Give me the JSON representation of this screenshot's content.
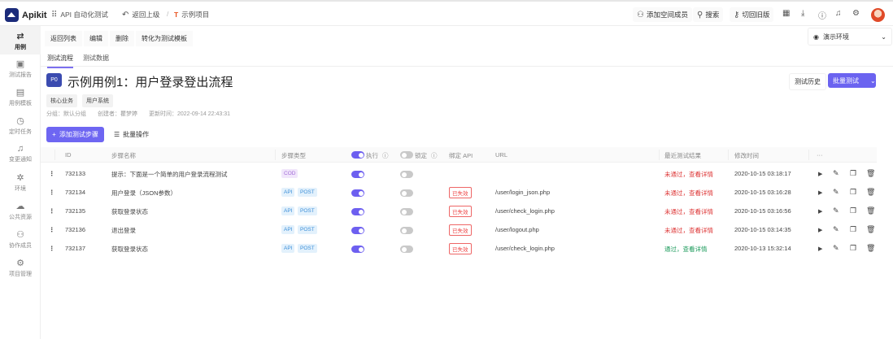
{
  "topbar": {
    "brand": "Apikit",
    "module": "API 自动化测试",
    "back": "返回上级",
    "project": "示例项目",
    "add_member": "添加空间成员",
    "search": "搜索",
    "old_version": "切回旧版"
  },
  "sidebar": {
    "items": [
      {
        "label": "用例",
        "icon": "swap-icon"
      },
      {
        "label": "测试报告",
        "icon": "report-icon"
      },
      {
        "label": "用例模板",
        "icon": "template-icon"
      },
      {
        "label": "定时任务",
        "icon": "timer-icon"
      },
      {
        "label": "变更通知",
        "icon": "bell-icon"
      },
      {
        "label": "环境",
        "icon": "environment-icon"
      },
      {
        "label": "公共资源",
        "icon": "resource-icon"
      },
      {
        "label": "协作成员",
        "icon": "members-icon"
      },
      {
        "label": "项目管理",
        "icon": "settings-icon"
      }
    ]
  },
  "actions": {
    "back_list": "返回列表",
    "edit": "编辑",
    "delete": "删除",
    "to_template": "转化为测试模板"
  },
  "environment": {
    "selected": "演示环境"
  },
  "tabs": [
    {
      "label": "测试流程"
    },
    {
      "label": "测试数据"
    }
  ],
  "case": {
    "priority": "P0",
    "title": "示例用例1：用户登录登出流程",
    "tags": [
      "核心业务",
      "用户系统"
    ],
    "group": "分组：默认分组",
    "creator": "创建者：瞿梦婷",
    "updated": "更新时间：2022-09-14 22:43:31"
  },
  "buttons": {
    "history": "测试历史",
    "batch_test": "批量测试",
    "add_step": "添加测试步骤",
    "bulk_ops": "批量操作"
  },
  "table": {
    "headers": {
      "id": "ID",
      "name": "步骤名称",
      "type": "步骤类型",
      "exec": "执行",
      "lock": "锁定",
      "bind": "绑定 API",
      "url": "URL",
      "result": "最近测试结果",
      "time": "修改时间",
      "more": "···"
    },
    "rows": [
      {
        "id": "732133",
        "name": "提示：下面是一个简单的用户登录流程测试",
        "types": [
          "COD"
        ],
        "exec": true,
        "lock": false,
        "bind": "",
        "url": "",
        "result": "未通过，查看详情",
        "status": "fail",
        "time": "2020-10-15 03:18:17"
      },
      {
        "id": "732134",
        "name": "用户登录（JSON参数）",
        "types": [
          "API",
          "POST"
        ],
        "exec": true,
        "lock": false,
        "bind": "已失效",
        "url": "/user/login_json.php",
        "result": "未通过，查看详情",
        "status": "fail",
        "time": "2020-10-15 03:16:28"
      },
      {
        "id": "732135",
        "name": "获取登录状态",
        "types": [
          "API",
          "POST"
        ],
        "exec": true,
        "lock": false,
        "bind": "已失效",
        "url": "/user/check_login.php",
        "result": "未通过，查看详情",
        "status": "fail",
        "time": "2020-10-15 03:16:56"
      },
      {
        "id": "732136",
        "name": "退出登录",
        "types": [
          "API",
          "POST"
        ],
        "exec": true,
        "lock": false,
        "bind": "已失效",
        "url": "/user/logout.php",
        "result": "未通过，查看详情",
        "status": "fail",
        "time": "2020-10-15 03:14:35"
      },
      {
        "id": "732137",
        "name": "获取登录状态",
        "types": [
          "API",
          "POST"
        ],
        "exec": true,
        "lock": false,
        "bind": "已失效",
        "url": "/user/check_login.php",
        "result": "通过，查看详情",
        "status": "pass",
        "time": "2020-10-13 15:32:14"
      }
    ]
  },
  "colors": {
    "accent": "#6b63f0",
    "fail": "#dd3333",
    "pass": "#1a9a5a"
  }
}
